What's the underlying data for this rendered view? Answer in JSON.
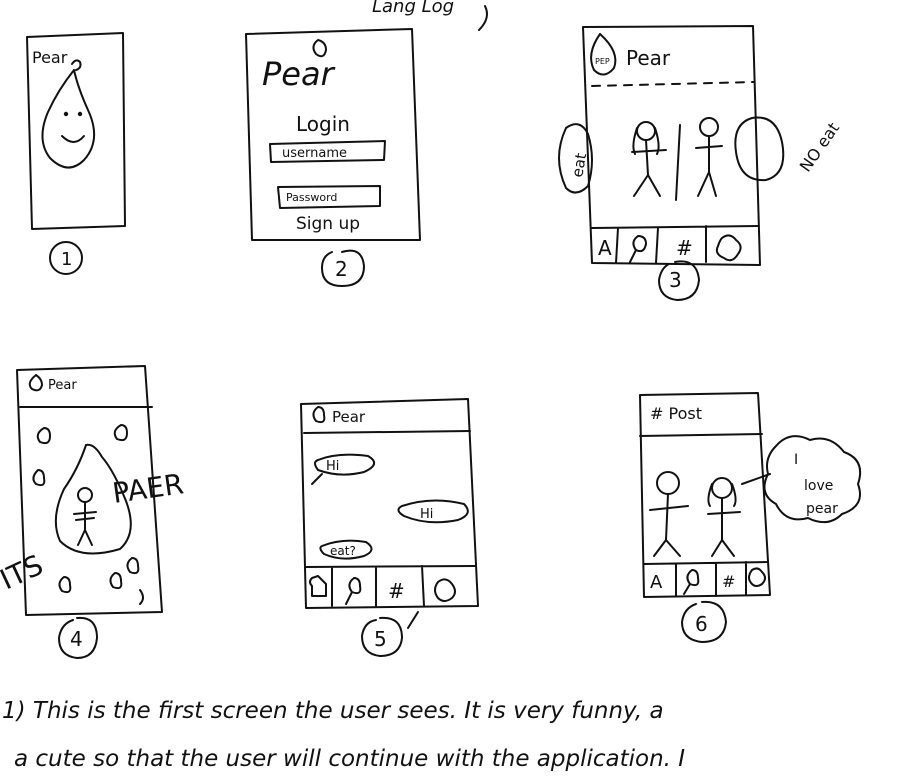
{
  "top_note": "Lang Log",
  "frame1": {
    "brand": "Pear",
    "number": "1"
  },
  "frame2": {
    "brand": "Pear",
    "login": "Login",
    "username": "username",
    "password": "Password",
    "signup": "Sign up",
    "number": "2"
  },
  "frame3": {
    "brand": "Pear",
    "pear_label": "PEP",
    "eat": "eat",
    "no_eat": "NO eat",
    "nav": [
      "A",
      "#"
    ],
    "number": "3"
  },
  "frame4": {
    "brand": "Pear",
    "its": "ITS",
    "pair": "PAER",
    "number": "4"
  },
  "frame5": {
    "brand": "Pear",
    "msg1": "Hi",
    "msg2": "Hi",
    "msg3": "eat?",
    "nav": [
      "#"
    ],
    "number": "5"
  },
  "frame6": {
    "title": "# Post",
    "bubble": [
      "I",
      "love",
      "pear"
    ],
    "nav": [
      "A",
      "#"
    ],
    "number": "6"
  },
  "caption": {
    "line1": "1) This is the first screen the user sees. It is very funny, a",
    "line2": "a cute so that the user will continue with the application. I"
  }
}
